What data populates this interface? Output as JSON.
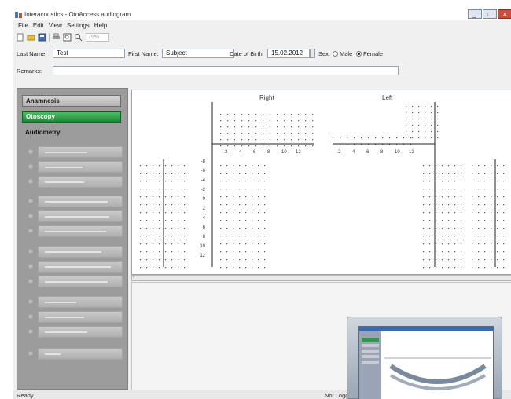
{
  "window": {
    "title": "Interacoustics - OtoAccess audiogram",
    "minimize_glyph": "_",
    "maximize_glyph": "□",
    "close_glyph": "✕"
  },
  "menu": [
    "File",
    "Edit",
    "View",
    "Settings",
    "Help"
  ],
  "toolbar": {
    "icons": [
      "new-icon",
      "open-icon",
      "save-icon",
      "print-icon",
      "preview-icon",
      "zoom-icon"
    ],
    "zoom_value": "75%"
  },
  "patient": {
    "last_name_label": "Last Name:",
    "last_name_value": "Test",
    "first_name_label": "First Name:",
    "first_name_value": "Subject",
    "dob_label": "Date of Birth:",
    "dob_value": "15.02.2012",
    "sex_label": "Sex:",
    "male_label": "Male",
    "female_label": "Female",
    "selected_sex": "Female",
    "remarks_label": "Remarks:",
    "remarks_value": ""
  },
  "sidebar": {
    "nav": [
      {
        "label": "Anamnesis",
        "active": false
      },
      {
        "label": "Otoscopy",
        "active": true
      }
    ],
    "section_heading": "Audiometry",
    "sub_items_count_note": ""
  },
  "charts": {
    "right_title": "Right",
    "left_title": "Left",
    "left_axis_ticks": [
      "-8",
      "-6",
      "-4",
      "-2",
      "0",
      "2",
      "4",
      "6",
      "8",
      "10",
      "12"
    ],
    "top_axis_ticks": [
      "2",
      "4",
      "6",
      "8",
      "10",
      "12"
    ]
  },
  "status": {
    "left_text": "Ready",
    "right_text": "Not Logged in"
  },
  "colors": {
    "active_nav": "#1e8a36",
    "sidebar_bg": "#9c9c9c",
    "close_button": "#d04a3a"
  }
}
